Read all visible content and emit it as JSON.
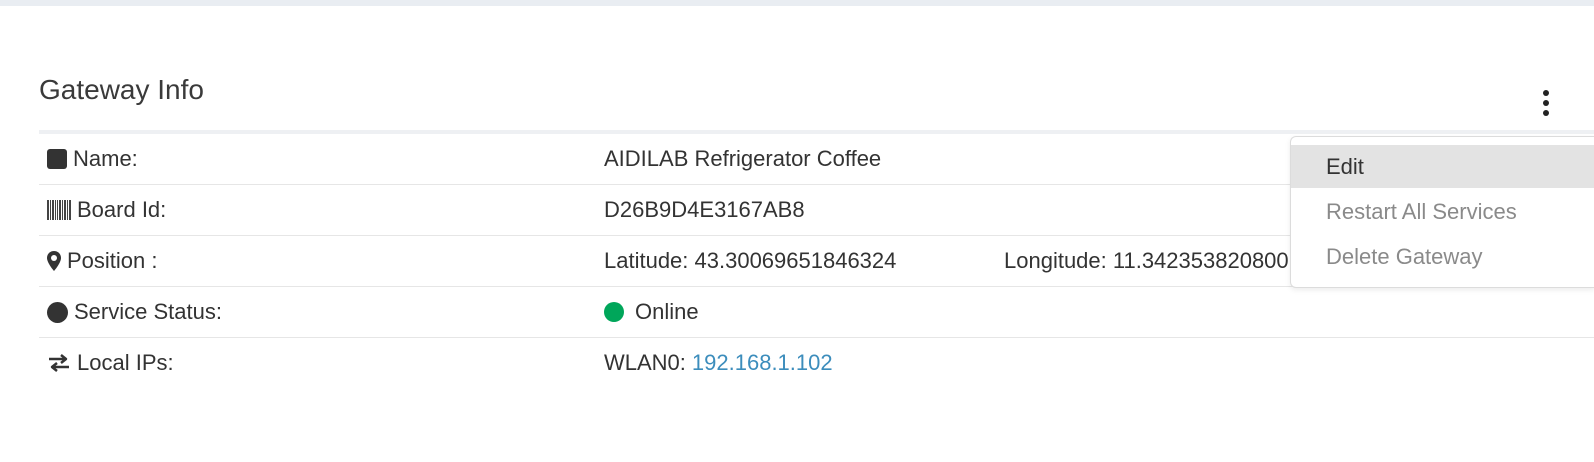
{
  "panel": {
    "title": "Gateway Info"
  },
  "rows": {
    "name": {
      "label": "Name:",
      "icon": "square-icon",
      "value": "AIDILAB Refrigerator Coffee"
    },
    "board_id": {
      "label": "Board Id:",
      "icon": "barcode-icon",
      "value": "D26B9D4E3167AB8"
    },
    "position": {
      "label": "Position :",
      "icon": "map-marker-icon",
      "latitude": "Latitude: 43.30069651846324",
      "longitude": "Longitude: 11.342353820800"
    },
    "service_status": {
      "label": "Service Status:",
      "icon": "circle-icon",
      "value": "Online",
      "status_color": "#00a65a"
    },
    "local_ips": {
      "label": "Local IPs:",
      "icon": "exchange-icon",
      "interface": "WLAN0:",
      "ip": "192.168.1.102",
      "link_color": "#3c8dbc"
    }
  },
  "menu": {
    "icon": "kebab-menu-icon",
    "items": [
      {
        "label": "Edit"
      },
      {
        "label": "Restart All Services"
      },
      {
        "label": "Delete Gateway"
      }
    ]
  }
}
